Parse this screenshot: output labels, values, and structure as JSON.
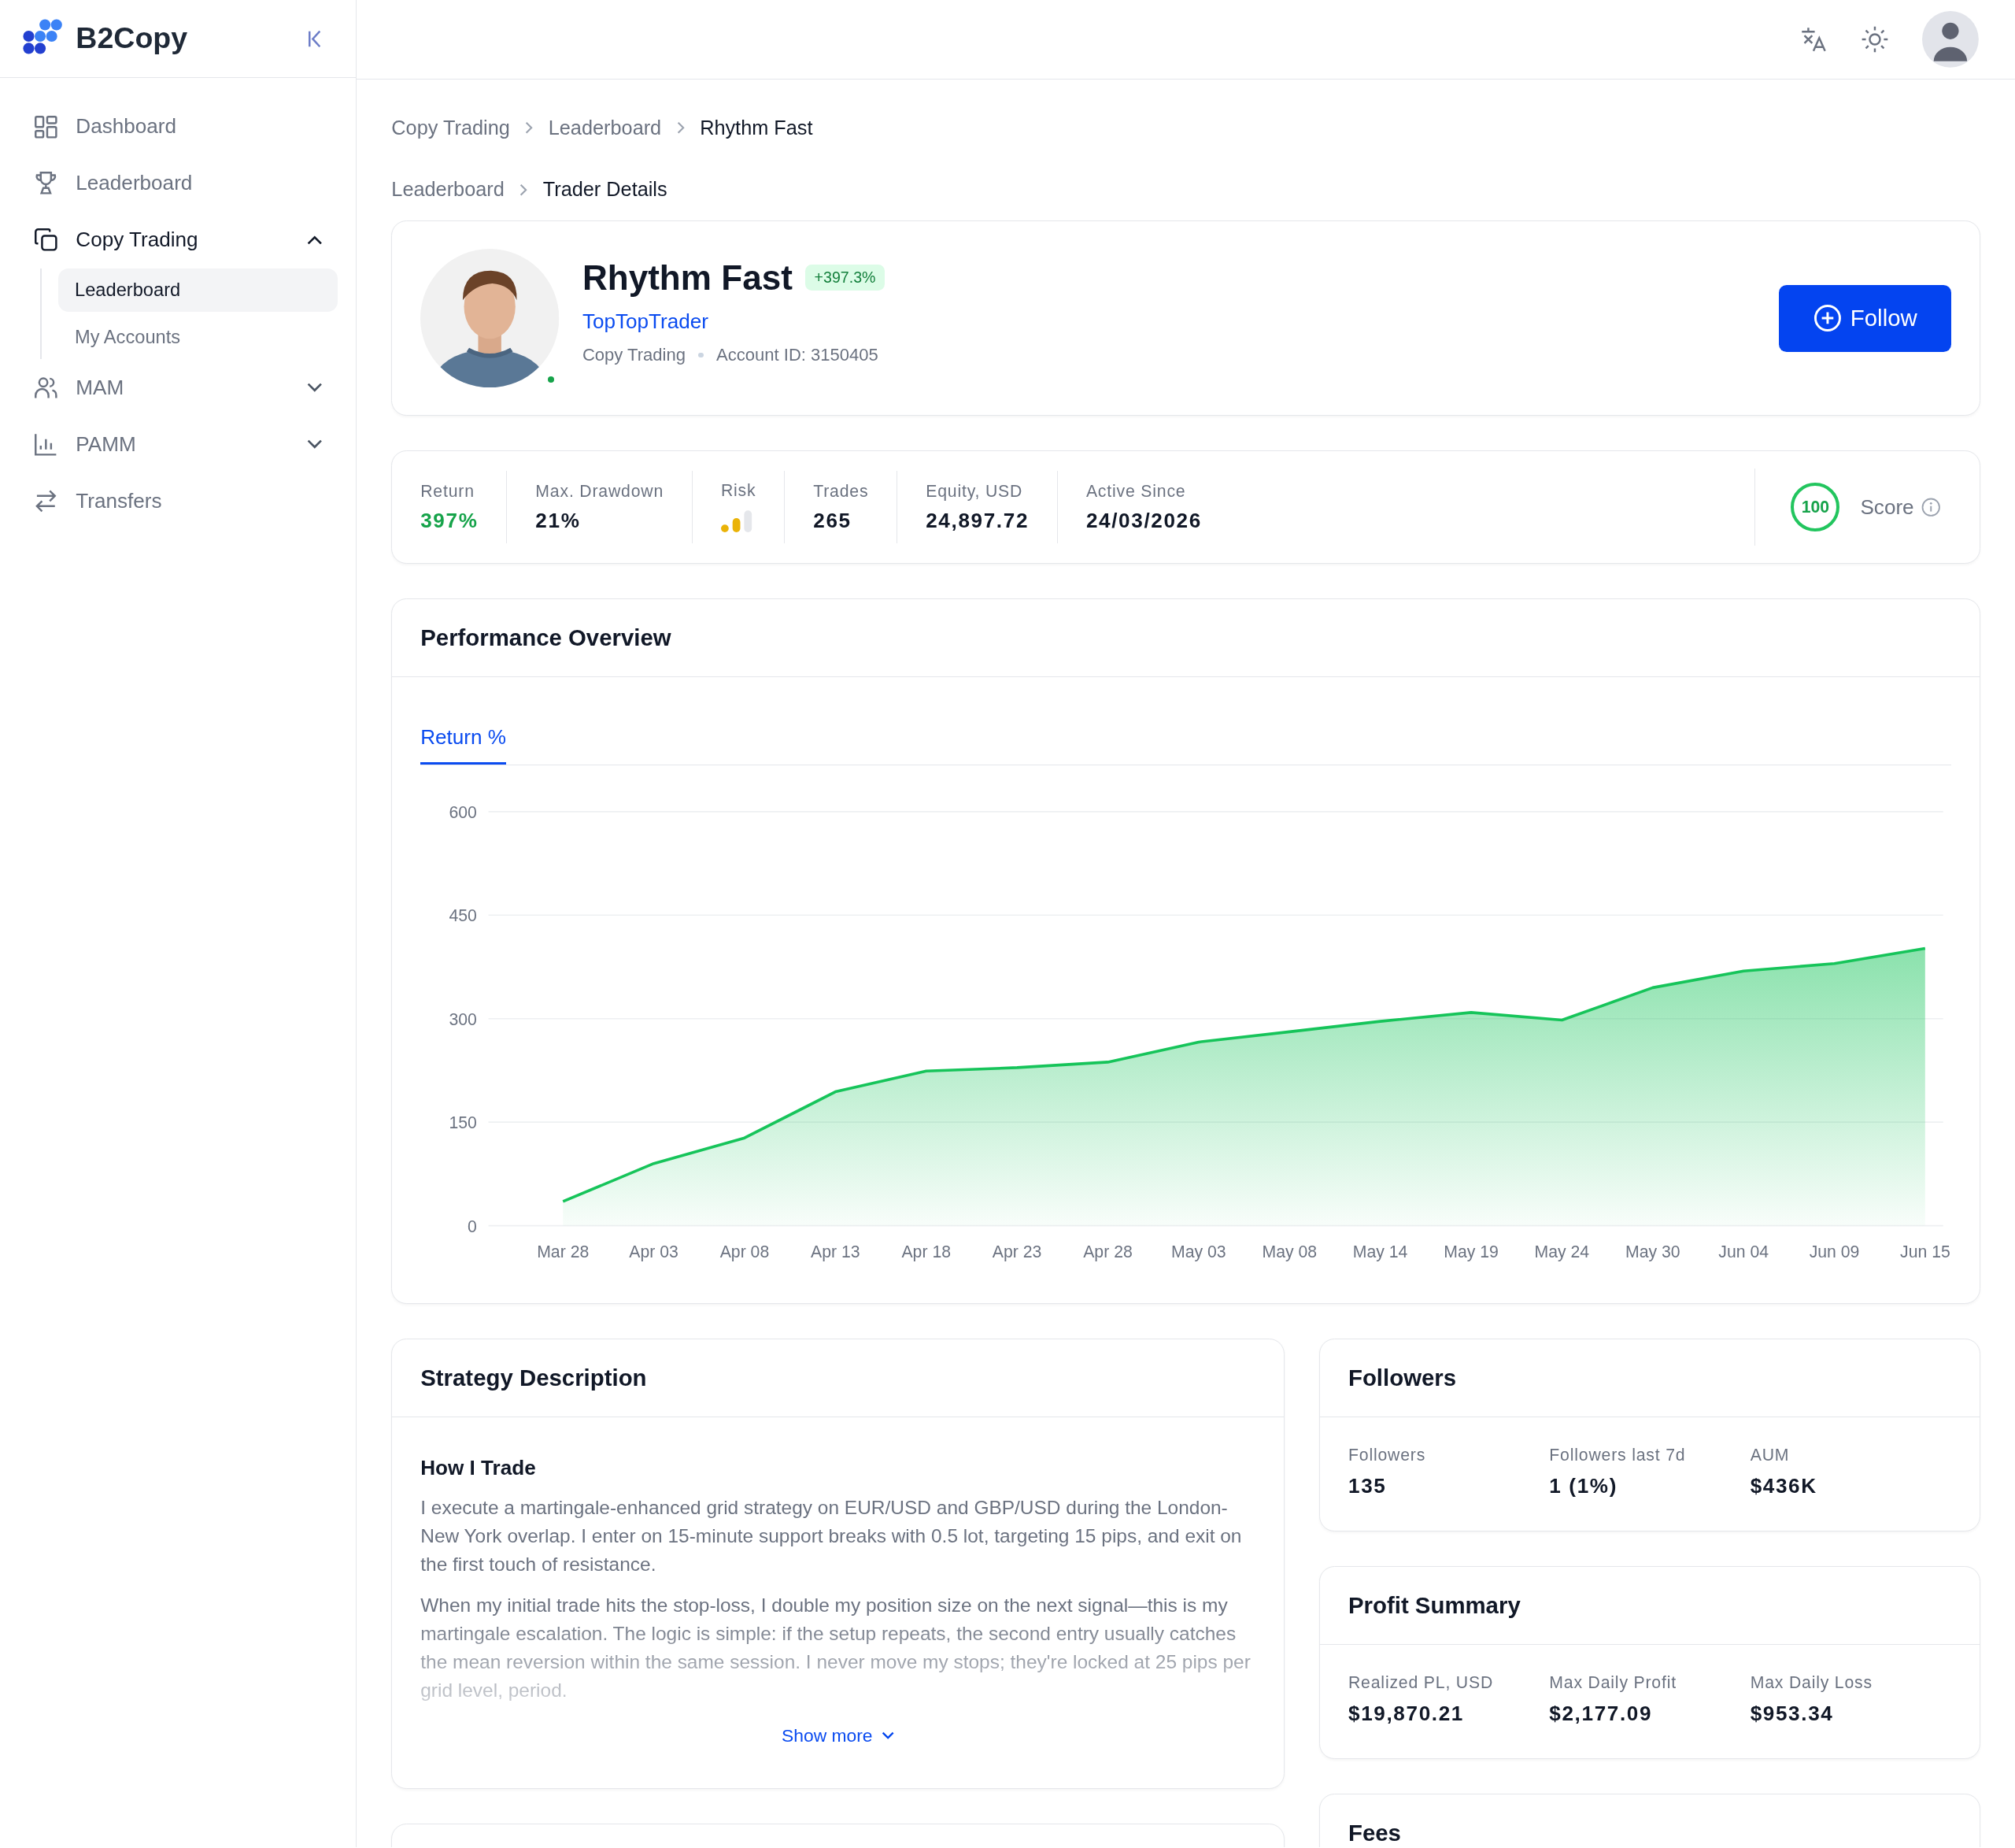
{
  "sidebar": {
    "brand": "B2Copy",
    "items": [
      {
        "label": "Dashboard",
        "kind": "link",
        "selected": false
      },
      {
        "label": "Leaderboard",
        "kind": "link",
        "selected": false
      },
      {
        "label": "Copy Trading",
        "kind": "group",
        "selected": true,
        "expanded": true,
        "children": [
          {
            "label": "Leaderboard",
            "selected": true
          },
          {
            "label": "My Accounts",
            "selected": false
          }
        ]
      },
      {
        "label": "MAM",
        "kind": "group",
        "selected": false,
        "expanded": false
      },
      {
        "label": "PAMM",
        "kind": "group",
        "selected": false,
        "expanded": false
      },
      {
        "label": "Transfers",
        "kind": "link",
        "selected": false
      }
    ]
  },
  "breadcrumbs": [
    {
      "label": "Copy Trading",
      "current": false
    },
    {
      "label": "Leaderboard",
      "current": false
    },
    {
      "label": "Rhythm Fast",
      "current": true
    }
  ],
  "sub_breadcrumbs": [
    {
      "label": "Leaderboard",
      "current": false
    },
    {
      "label": "Trader Details",
      "current": true
    }
  ],
  "profile": {
    "avatar": {
      "kind": "picture"
    },
    "online": true,
    "name": "Rhythm Fast",
    "badge": "+397.3%",
    "username": "TopTopTrader",
    "meta": [
      "Copy Trading",
      "Account ID: 3150405"
    ],
    "follow_button": "Follow"
  },
  "stats": [
    {
      "label": "Return",
      "kind": "positive",
      "value": "397%"
    },
    {
      "label": "Max. Drawdown",
      "kind": "plain",
      "value": "21%"
    },
    {
      "label": "Risk",
      "kind": "meter",
      "level": 0.67
    },
    {
      "label": "Trades",
      "kind": "plain",
      "value": "265"
    },
    {
      "label": "Equity, USD",
      "kind": "plain",
      "value": "24,897.72"
    },
    {
      "label": "Active Since",
      "kind": "plain",
      "value": "24/03/2026"
    }
  ],
  "score": {
    "value": "100",
    "label": "Score"
  },
  "performance": {
    "title": "Performance Overview",
    "tabs": [
      {
        "label": "Return %",
        "selected": true
      }
    ],
    "chart_data": {
      "type": "area",
      "grid": true,
      "ylim": [
        0,
        600
      ],
      "yticks": [
        0,
        150,
        300,
        450,
        600
      ],
      "categories": [
        "Mar 28",
        "Apr 03",
        "Apr 08",
        "Apr 13",
        "Apr 18",
        "Apr 23",
        "Apr 28",
        "May 03",
        "May 08",
        "May 14",
        "May 19",
        "May 24",
        "May 30",
        "Jun 04",
        "Jun 09",
        "Jun 15"
      ],
      "series": [
        {
          "color": "#16c45a",
          "values": [
            35,
            90,
            127,
            194,
            224,
            229,
            237,
            266,
            281,
            296,
            309,
            298,
            345,
            369,
            380,
            402
          ]
        }
      ]
    }
  },
  "strategy": {
    "title": "Strategy Description",
    "heading": "How I Trade",
    "paragraphs": [
      "I execute a martingale-enhanced grid strategy on EUR/USD and GBP/USD during the London-New York overlap. I enter on 15-minute support breaks with 0.5 lot, targeting 15 pips, and exit on the first touch of resistance.",
      "When my initial trade hits the stop-loss, I double my position size on the next signal—this is my martingale escalation. The logic is simple: if the setup repeats, the second entry usually catches the mean reversion within the same session. I never move my stops; they're locked at 25 pips per grid level, period."
    ],
    "show_more": "Show more"
  },
  "followers": {
    "title": "Followers",
    "stats": [
      {
        "label": "Followers",
        "value": "135"
      },
      {
        "label": "Followers last 7d",
        "value": "1 (1%)"
      },
      {
        "label": "AUM",
        "value": "$436K"
      }
    ]
  },
  "profit_summary": {
    "title": "Profit Summary",
    "stats": [
      {
        "label": "Realized PL, USD",
        "value": "$19,870.21"
      },
      {
        "label": "Max Daily Profit",
        "value": "$2,177.09"
      },
      {
        "label": "Max Daily Loss",
        "value": "$953.34"
      }
    ]
  },
  "fees": {
    "title": "Fees"
  }
}
